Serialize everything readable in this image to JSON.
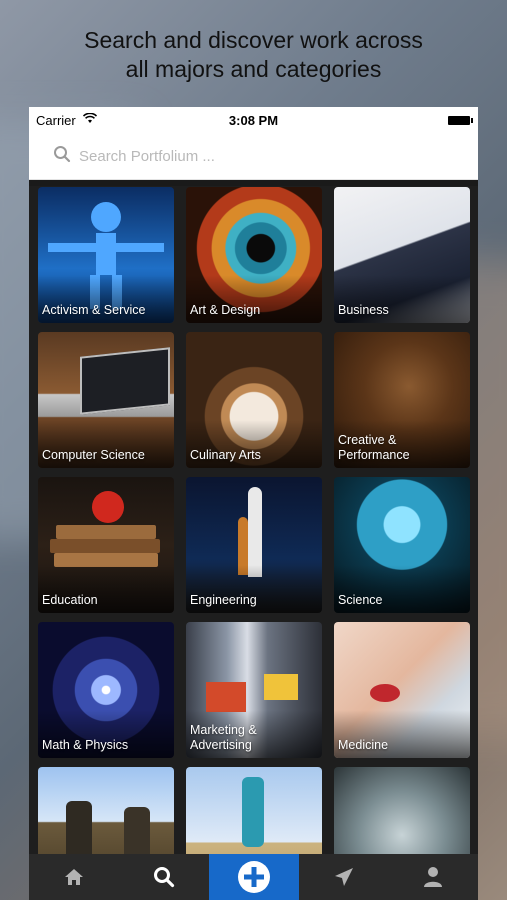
{
  "headline": "Search and discover work across\nall majors and categories",
  "status_bar": {
    "carrier": "Carrier",
    "time": "3:08 PM"
  },
  "search": {
    "placeholder": "Search Portfolium ..."
  },
  "categories": [
    {
      "label": "Activism & Service"
    },
    {
      "label": "Art & Design"
    },
    {
      "label": "Business"
    },
    {
      "label": "Computer Science"
    },
    {
      "label": "Culinary Arts"
    },
    {
      "label": "Creative &\nPerformance"
    },
    {
      "label": "Education"
    },
    {
      "label": "Engineering"
    },
    {
      "label": "Science"
    },
    {
      "label": "Math & Physics"
    },
    {
      "label": "Marketing &\nAdvertising"
    },
    {
      "label": "Medicine"
    },
    {
      "label": ""
    },
    {
      "label": ""
    },
    {
      "label": ""
    }
  ],
  "tabbar": {
    "items": [
      {
        "icon": "home-icon"
      },
      {
        "icon": "search-icon"
      },
      {
        "icon": "add-icon"
      },
      {
        "icon": "send-icon"
      },
      {
        "icon": "profile-icon"
      }
    ],
    "active_index": 2,
    "active_color": "#1769c9"
  },
  "colors": {
    "accent": "#1769c9",
    "grid_bg": "#1e1e1e",
    "tabbar_bg": "#2a2a2a"
  }
}
